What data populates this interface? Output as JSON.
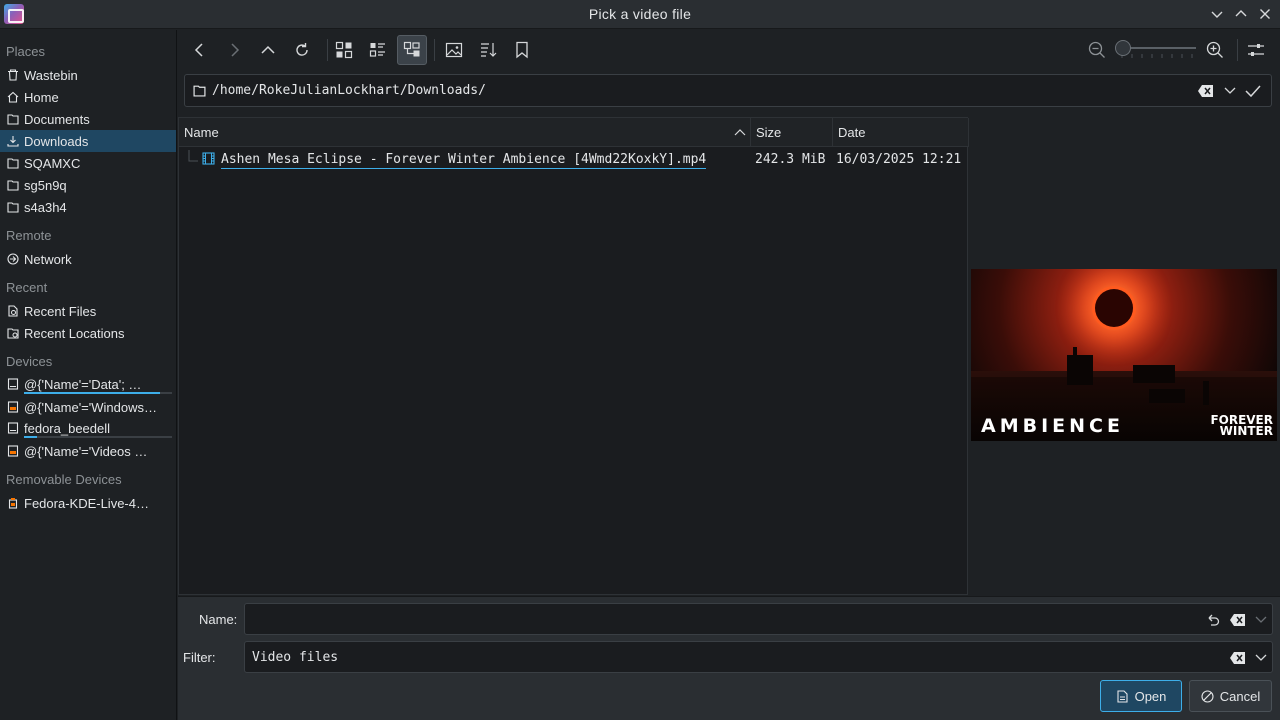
{
  "window": {
    "title": "Pick a video file"
  },
  "sidebar": {
    "sections": {
      "places": "Places",
      "remote": "Remote",
      "recent": "Recent",
      "devices": "Devices",
      "removable": "Removable Devices"
    },
    "places": [
      {
        "label": "Wastebin",
        "icon": "trash-icon"
      },
      {
        "label": "Home",
        "icon": "home-icon"
      },
      {
        "label": "Documents",
        "icon": "documents-icon"
      },
      {
        "label": "Downloads",
        "icon": "download-icon",
        "selected": true
      },
      {
        "label": "SQAMXC",
        "icon": "folder-icon"
      },
      {
        "label": "sg5n9q",
        "icon": "folder-icon"
      },
      {
        "label": "s4a3h4",
        "icon": "folder-icon"
      }
    ],
    "remote": [
      {
        "label": "Network",
        "icon": "network-icon"
      }
    ],
    "recent": [
      {
        "label": "Recent Files",
        "icon": "recent-files-icon"
      },
      {
        "label": "Recent Locations",
        "icon": "recent-locations-icon"
      }
    ],
    "devices": [
      {
        "label": "@{'Name'='Data'; …",
        "icon": "drive-icon",
        "usage": 0.92
      },
      {
        "label": "@{'Name'='Windows…",
        "icon": "drive-orange-icon"
      },
      {
        "label": "fedora_beedell",
        "icon": "drive-icon",
        "usage": 0.09
      },
      {
        "label": "@{'Name'='Videos …",
        "icon": "drive-orange-icon"
      }
    ],
    "removable": [
      {
        "label": "Fedora-KDE-Live-4…",
        "icon": "usb-drive-icon"
      }
    ]
  },
  "toolbar": {
    "back": "back-icon",
    "forward": "forward-icon",
    "up": "up-icon",
    "reload": "reload-icon",
    "view_icons": "icon-view-icon",
    "view_compact": "compact-view-icon",
    "view_tree": "tree-view-icon",
    "preview": "preview-icon",
    "sort": "sort-icon",
    "bookmark": "bookmark-icon",
    "zoom_out": "zoom-out-icon",
    "zoom_in": "zoom-in-icon",
    "zoom_level": 0.05,
    "options": "options-icon"
  },
  "path": {
    "value": "/home/RokeJulianLockhart/Downloads/"
  },
  "columns": {
    "name": "Name",
    "size": "Size",
    "date": "Date"
  },
  "files": [
    {
      "name": "Ashen Mesa Eclipse - Forever Winter Ambience [4Wmd22KoxkY].mp4",
      "size": "242.3 MiB",
      "date": "16/03/2025 12:21"
    }
  ],
  "preview": {
    "caption_left": "AMBIENCE",
    "caption_right_1": "FOREVER",
    "caption_right_2": "WINTER"
  },
  "form": {
    "name_label": "Name:",
    "name_value": "",
    "filter_label": "Filter:",
    "filter_value": "Video files"
  },
  "buttons": {
    "open": "Open",
    "cancel": "Cancel"
  },
  "colors": {
    "accent": "#3daee9",
    "selection": "#1f4762",
    "background": "#1e2124"
  }
}
